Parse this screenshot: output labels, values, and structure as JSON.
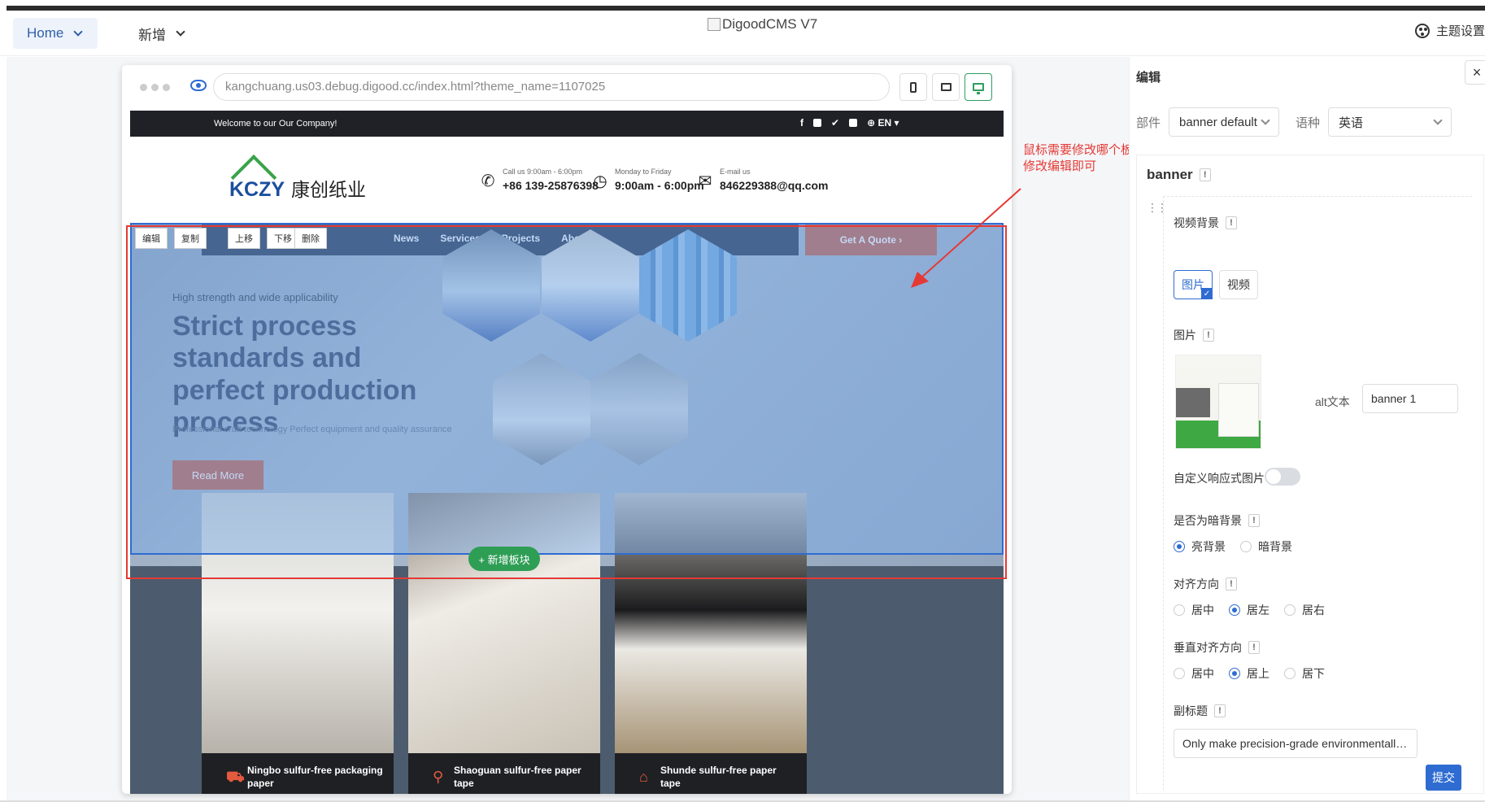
{
  "topbar": {
    "home_label": "Home",
    "add_label": "新增",
    "brand_alt": "DigoodCMS V7",
    "theme_label": "主题设置"
  },
  "browser": {
    "url": "kangchuang.us03.debug.digood.cc/index.html?theme_name=1107025"
  },
  "site": {
    "welcome": "Welcome to our Our Company!",
    "language": "EN",
    "logo_latin": "KCZY",
    "logo_cn": "康创纸业",
    "contacts": [
      {
        "icon": "phone-icon",
        "glyph": "✆",
        "label": "Call us 9:00am - 6:00pm",
        "value": "+86 139-25876398"
      },
      {
        "icon": "clock-icon",
        "glyph": "◷",
        "label": "Monday to Friday",
        "value": "9:00am - 6:00pm"
      },
      {
        "icon": "mail-icon",
        "glyph": "✉",
        "label": "E-mail us",
        "value": "846229388@qq.com"
      }
    ],
    "nav": [
      "News",
      "Services",
      "Projects",
      "About"
    ],
    "quote": "Get A Quote ›",
    "hero_sub": "High strength and wide applicability",
    "hero_title": "Strict process standards and perfect production process",
    "hero_desc": "Professional craft technology Perfect equipment and quality assurance",
    "read_more": "Read More",
    "cards": [
      {
        "icon": "truck-icon",
        "glyph": "⛟",
        "title": "Ningbo sulfur-free packaging paper"
      },
      {
        "icon": "location-pin-icon",
        "glyph": "⚲",
        "title": "Shaoguan sulfur-free paper tape"
      },
      {
        "icon": "warehouse-icon",
        "glyph": "⌂",
        "title": "Shunde sulfur-free paper tape"
      }
    ]
  },
  "block_tools": [
    "编辑",
    "复制",
    "上移",
    "下移",
    "删除"
  ],
  "add_block": "+ 新增板块",
  "annotation": "鼠标需要修改哪个板块的内容就点哪个板块，右侧会出现对应的字段进行修改编辑即可",
  "panel": {
    "title": "编辑",
    "close": "×",
    "part_label": "部件",
    "part_value": "banner default",
    "lang_label": "语种",
    "lang_value": "英语",
    "component_title": "banner",
    "video_bg_label": "视频背景",
    "video_bg_options": [
      "图片",
      "视频"
    ],
    "image_label": "图片",
    "alt_label": "alt文本",
    "alt_value": "banner 1",
    "responsive_label": "自定义响应式图片",
    "dark_bg_label": "是否为暗背景",
    "dark_bg_options": [
      "亮背景",
      "暗背景"
    ],
    "align_label": "对齐方向",
    "align_options": [
      "居中",
      "居左",
      "居右"
    ],
    "valign_label": "垂直对齐方向",
    "valign_options": [
      "居中",
      "居上",
      "居下"
    ],
    "subtitle_label": "副标题",
    "subtitle_value": "Only make precision-grade environmentally friendly ...",
    "submit": "提交"
  }
}
